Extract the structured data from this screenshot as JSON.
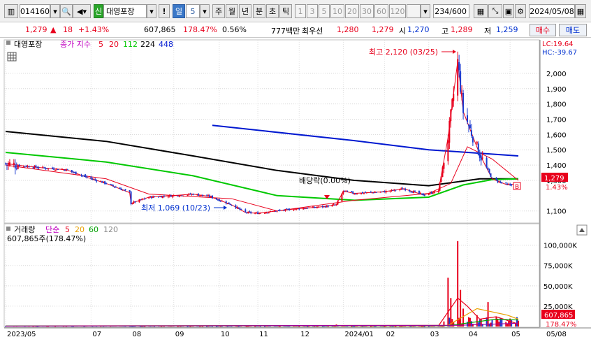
{
  "toolbar": {
    "code": "014160",
    "name_badge": "신",
    "stock_name": "대영포장",
    "alert": "!",
    "period_day": "일",
    "period_value": "5",
    "periods": [
      "주",
      "월",
      "년",
      "분",
      "초",
      "틱"
    ],
    "minutes": [
      "1",
      "3",
      "5",
      "10",
      "20",
      "30",
      "60",
      "120"
    ],
    "count": "234",
    "count_total": "/600",
    "date": "2024/05/08"
  },
  "infobar": {
    "price": "1,279",
    "change": "18",
    "change_pct": "+1.43%",
    "volume": "607,865",
    "volume_ratio": "178.47%",
    "turnover_pct": "0.56%",
    "trade_value": "777백만",
    "best_ask_label": "최우선",
    "best_ask": "1,280",
    "best_bid": "1,279",
    "open_label": "시",
    "open": "1,270",
    "high_label": "고",
    "high": "1,289",
    "low_label": "저",
    "low": "1,259",
    "buy_label": "매수",
    "sell_label": "매도"
  },
  "colors": {
    "up": "#e8001c",
    "down": "#1a3ad0",
    "ma5": "#e8001c",
    "ma20": "#e8001c",
    "ma112": "#00c800",
    "ma224": "#000000",
    "ma448": "#0018d0",
    "vol5": "#e8001c",
    "vol20": "#e8a000",
    "vol60": "#00a000",
    "vol120": "#a000a0"
  },
  "chart_data": [
    {
      "type": "candlestick",
      "title": "대영포장",
      "legend": {
        "prefix": "종가 지수",
        "items": [
          {
            "name": "5",
            "color": "#e8001c"
          },
          {
            "name": "20",
            "color": "#e8001c"
          },
          {
            "name": "112",
            "color": "#00c800"
          },
          {
            "name": "224",
            "color": "#000000"
          },
          {
            "name": "448",
            "color": "#0018d0"
          }
        ]
      },
      "ylim": [
        1030,
        2210
      ],
      "yticks": [
        "2,000",
        "1,900",
        "1,800",
        "1,700",
        "1,600",
        "1,500",
        "1,400",
        "1,300",
        "1,100"
      ],
      "ytick_values": [
        2000,
        1900,
        1800,
        1700,
        1600,
        1500,
        1400,
        1300,
        1100
      ],
      "xticks": [
        "2023/05",
        "07",
        "08",
        "09",
        "10",
        "11",
        "12",
        "2024/01",
        "02",
        "03",
        "04",
        "05",
        "05/08"
      ],
      "lc_label": "LC:19.64",
      "hc_label": "HC:-39.67",
      "current_price_label": "1,279",
      "current_pct_label": "1.43%",
      "ex_div_label": "배당락(0.00%)",
      "high_annotation": "최고 2,120 (03/25)",
      "low_annotation": "최저 1,069 (10/23)",
      "marker_b": "B",
      "close_series": {
        "dates": [
          "2023/05/02",
          "2023/05/15",
          "2023/05/31",
          "2023/06/15",
          "2023/06/30",
          "2023/07/14",
          "2023/07/31",
          "2023/08/01",
          "2023/08/14",
          "2023/08/31",
          "2023/09/15",
          "2023/09/27",
          "2023/10/13",
          "2023/10/23",
          "2023/10/31",
          "2023/11/15",
          "2023/11/30",
          "2023/12/15",
          "2023/12/20",
          "2023/12/28",
          "2024/01/02",
          "2024/01/10",
          "2024/01/31",
          "2024/02/15",
          "2024/02/29",
          "2024/03/11",
          "2024/03/18",
          "2024/03/25",
          "2024/03/29",
          "2024/04/10",
          "2024/04/19",
          "2024/04/30",
          "2024/05/08"
        ],
        "values": [
          1410,
          1395,
          1380,
          1370,
          1320,
          1280,
          1220,
          1150,
          1190,
          1200,
          1210,
          1195,
          1140,
          1090,
          1085,
          1100,
          1115,
          1125,
          1130,
          1140,
          1230,
          1215,
          1225,
          1245,
          1205,
          1230,
          1580,
          2080,
          1750,
          1470,
          1310,
          1270,
          1279
        ]
      },
      "ma_values": {
        "ma448": {
          "start": 1662,
          "end": 1460
        },
        "ma224": {
          "start": 1620,
          "end": 1310
        },
        "ma112": {
          "start": 1483,
          "end": 1310
        }
      }
    },
    {
      "type": "bar",
      "title": "거래량",
      "legend": {
        "prefix": "단순",
        "items": [
          {
            "name": "5",
            "color": "#e8001c"
          },
          {
            "name": "20",
            "color": "#e8a000"
          },
          {
            "name": "60",
            "color": "#00a000"
          },
          {
            "name": "120",
            "color": "#a000a0"
          }
        ]
      },
      "current_volume_label": "607,865주(178.47%)",
      "ylim": [
        0,
        110000
      ],
      "yticks": [
        "100,000K",
        "75,000K",
        "50,000K",
        "25,000K"
      ],
      "ytick_values": [
        100000,
        75000,
        50000,
        25000
      ],
      "current_volume_box": "607,865",
      "current_ratio_box": "178.47%",
      "spikes": [
        {
          "date": "2023/12/28",
          "value": 2500
        },
        {
          "date": "2024/03/18",
          "value": 60000
        },
        {
          "date": "2024/03/20",
          "value": 35000
        },
        {
          "date": "2024/03/25",
          "value": 105000
        },
        {
          "date": "2024/03/27",
          "value": 45000
        },
        {
          "date": "2024/03/29",
          "value": 22000
        },
        {
          "date": "2024/04/08",
          "value": 14000
        },
        {
          "date": "2024/04/16",
          "value": 30000
        },
        {
          "date": "2024/04/22",
          "value": 12000
        }
      ]
    }
  ]
}
